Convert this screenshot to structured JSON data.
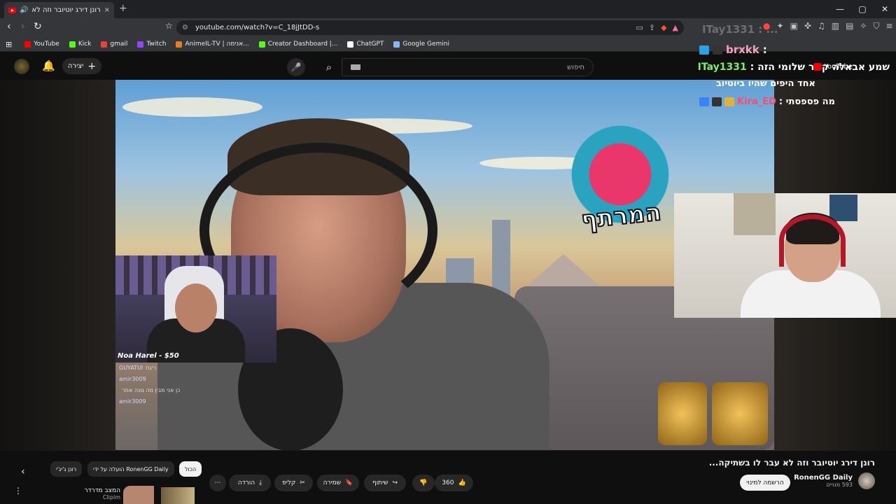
{
  "browser": {
    "tab_title": "רונן דירג יוטיובר וזה לא עבר לו",
    "tab_close": "×",
    "new_tab": "+",
    "url": "youtube.com/watch?v=C_18jJtDD-s",
    "window_controls": [
      "—",
      "▢",
      "✕"
    ]
  },
  "bookmarks": [
    {
      "label": "YouTube",
      "color": "#ff0000"
    },
    {
      "label": "Kick",
      "color": "#53fc18"
    },
    {
      "label": "gmail",
      "color": "#ea4335"
    },
    {
      "label": "Twitch",
      "color": "#9146ff"
    },
    {
      "label": "AnimeIL-TV | אנימה...",
      "color": "#e67e22"
    },
    {
      "label": "Creator Dashboard |...",
      "color": "#53fc18"
    },
    {
      "label": "ChatGPT",
      "color": "#ffffff"
    },
    {
      "label": "Google Gemini",
      "color": "#8ab4f8"
    }
  ],
  "youtube_header": {
    "create_label": "יצירה",
    "search_placeholder": "חיפוש"
  },
  "video_overlay": {
    "chat_top": "ITay1331 : ...",
    "chat_user2": "brxkk",
    "chat_line3_user": "ITay1331",
    "chat_line3_text": "שמע אבאלה קשר שלומי הזה :",
    "chat_line4_text": "אחד היפים שהיו ביוטיוב",
    "chat_line5_user": "Kira_ED",
    "chat_line5_text": "מה פספסתי :",
    "yt_badge": "YouTube",
    "logo_text": "המרתף",
    "donation": "Noa Harel - $50",
    "minichat": [
      {
        "user": "GUYATUI",
        "text": "ריגת"
      },
      {
        "user": "amir3009",
        "text": ""
      },
      {
        "user": "",
        "text": "כן אני מבין מה גונה אמר"
      },
      {
        "user": "amir3009",
        "text": ""
      }
    ]
  },
  "video_info": {
    "title": "רונן דירג יוטיובר וזה לא עבר לו בשתיקה...",
    "channel": "RonenGG Daily",
    "subscribers": "593 מנויים",
    "subscribe_label": "הרשמה למינוי",
    "likes": "360",
    "share_label": "שיתוף",
    "save_label": "שמירה",
    "clip_label": "קליפ",
    "download_label": "הורדה"
  },
  "chips": [
    {
      "label": "הכול",
      "active": true
    },
    {
      "label": "הועלה על ידי RonenGG Daily",
      "active": false
    },
    {
      "label": "רונן ג'יג'י",
      "active": false
    }
  ],
  "recommendation": {
    "title": "המצב מדרדר",
    "channel": "Clipim"
  },
  "colors": {
    "background": "#0f0f0f",
    "accent_red": "#ff0000",
    "chat_green": "#7cf05c",
    "chat_pink": "#f6a2c0"
  }
}
